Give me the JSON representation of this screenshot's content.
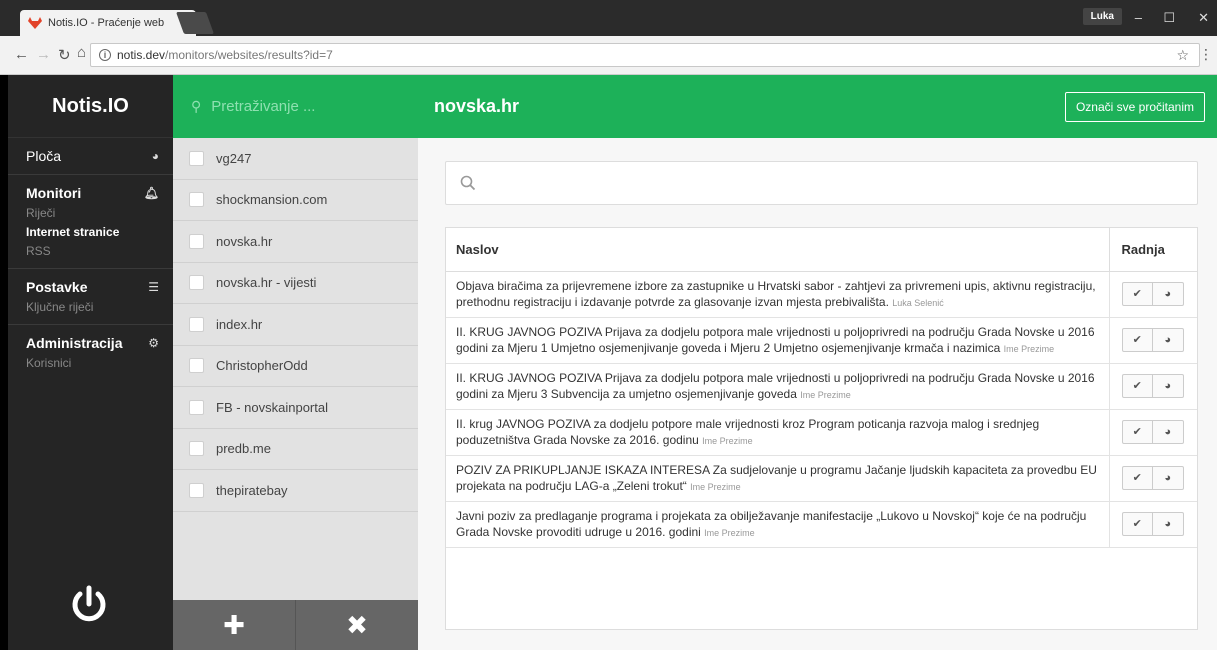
{
  "browser": {
    "tab_title": "Notis.IO - Praćenje web",
    "tab_close": "×",
    "user": "Luka",
    "url_host": "notis.dev",
    "url_path": "/monitors/websites/results?id=7"
  },
  "sidebar": {
    "brand": "Notis.IO",
    "dashboard": "Ploča",
    "monitors": {
      "label": "Monitori",
      "items": [
        "Riječi",
        "Internet stranice",
        "RSS"
      ]
    },
    "settings": {
      "label": "Postavke",
      "items": [
        "Ključne riječi"
      ]
    },
    "admin": {
      "label": "Administracija",
      "items": [
        "Korisnici"
      ]
    }
  },
  "list": {
    "search_placeholder": "Pretraživanje ...",
    "sites": [
      "vg247",
      "shockmansion.com",
      "novska.hr",
      "novska.hr - vijesti",
      "index.hr",
      "ChristopherOdd",
      "FB - novskainportal",
      "predb.me",
      "thepiratebay"
    ]
  },
  "main": {
    "title": "novska.hr",
    "mark_all": "Označi sve pročitanim",
    "col_title": "Naslov",
    "col_action": "Radnja",
    "rows": [
      {
        "text": "Objava biračima za prijevremene izbore za zastupnike u Hrvatski sabor - zahtjevi za privremeni upis, aktivnu registraciju, prethodnu registraciju i izdavanje potvrde za glasovanje izvan mjesta prebivališta.",
        "author": "Luka Selenić"
      },
      {
        "text": "II. KRUG JAVNOG POZIVA Prijava za dodjelu potpora male vrijednosti u poljoprivredi na području Grada Novske u 2016 godini za Mjeru 1 Umjetno osjemenjivanje goveda i Mjeru 2 Umjetno osjemenjivanje krmača i nazimica",
        "author": "Ime Prezime"
      },
      {
        "text": "II. KRUG JAVNOG POZIVA Prijava za dodjelu potpora male vrijednosti u poljoprivredi na području Grada Novske u 2016 godini za Mjeru 3 Subvencija za umjetno osjemenjivanje goveda",
        "author": "Ime Prezime"
      },
      {
        "text": "II. krug JAVNOG POZIVA za dodjelu potpore male vrijednosti kroz Program poticanja razvoja malog i srednjeg poduzetništva Grada Novske za 2016. godinu",
        "author": "Ime Prezime"
      },
      {
        "text": "POZIV ZA PRIKUPLJANJE ISKAZA INTERESA Za sudjelovanje u programu Jačanje ljudskih kapaciteta za provedbu EU projekata na području LAG-a „Zeleni trokut“",
        "author": "Ime Prezime"
      },
      {
        "text": "Javni poziv za predlaganje programa i projekata za obilježavanje manifestacije „Lukovo u Novskoj“ koje će na području Grada Novske provoditi udruge u 2016. godini",
        "author": "Ime Prezime"
      }
    ]
  },
  "colors": {
    "accent": "#1db159",
    "sidebar": "#252525"
  }
}
